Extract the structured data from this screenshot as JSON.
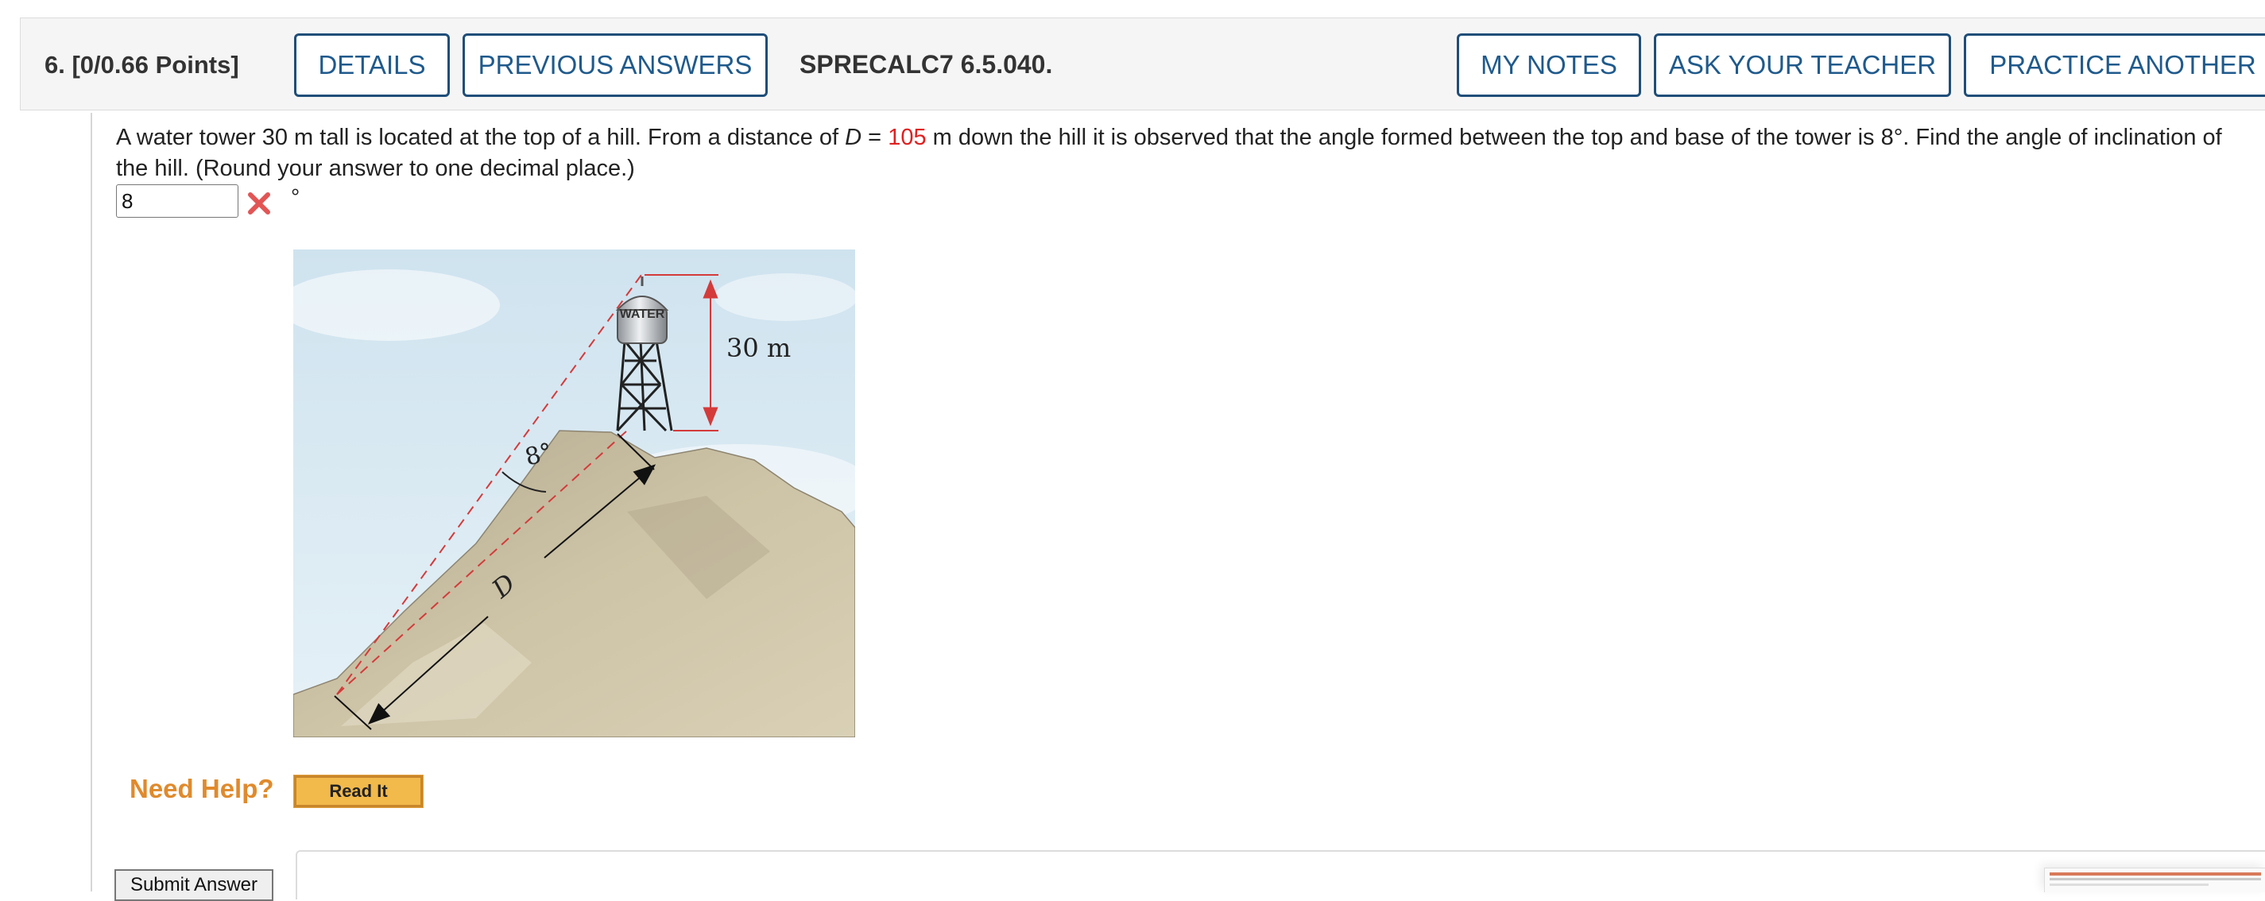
{
  "question": {
    "number_label": "6.",
    "points_label": "[0/0.66 Points]",
    "code": "SPRECALC7 6.5.040."
  },
  "toolbar": {
    "details": "DETAILS",
    "previous_answers": "PREVIOUS ANSWERS",
    "my_notes": "MY NOTES",
    "ask_teacher": "ASK YOUR TEACHER",
    "practice_another": "PRACTICE ANOTHER"
  },
  "problem": {
    "text_part1": "A water tower 30 m tall is located at the top of a hill. From a distance of ",
    "var_d": "D",
    "equals": " = ",
    "distance_value": "105",
    "text_part2": " m down the hill it is observed that the angle formed between the top and base of the tower is 8°. Find the angle of inclination of the hill. (Round your answer to one decimal place.)"
  },
  "answer": {
    "value": "8",
    "unit": "°",
    "status": "incorrect"
  },
  "figure": {
    "tank_label": "WATER",
    "height_label": "30 m",
    "angle_label": "8°",
    "distance_label": "D"
  },
  "help": {
    "label": "Need Help?",
    "read_it": "Read It"
  },
  "submit": {
    "label": "Submit Answer"
  },
  "colors": {
    "button_border": "#1f4e79",
    "button_text": "#1f5a8c",
    "accent_red": "#e02020",
    "need_help": "#e08a2c",
    "read_it_bg": "#f2b94b"
  }
}
